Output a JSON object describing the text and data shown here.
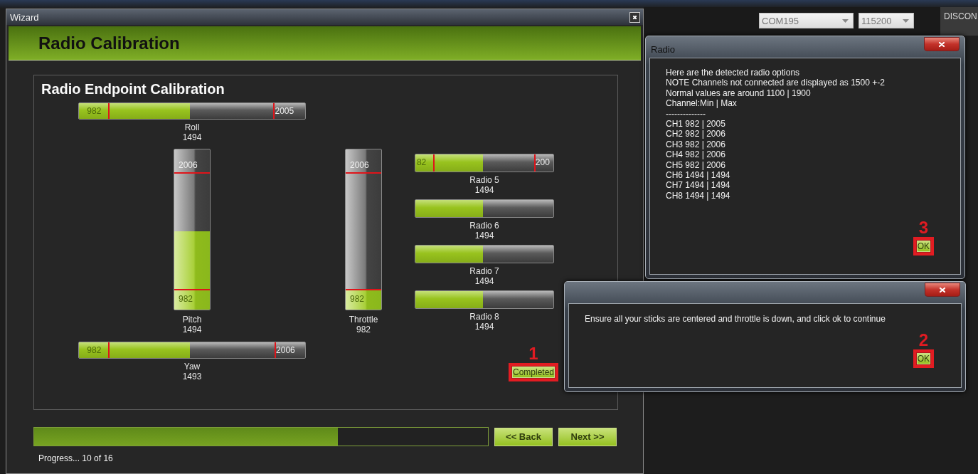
{
  "toolbar": {
    "port": "COM195",
    "baud": "115200",
    "connect_tab": "DISCON"
  },
  "wizard": {
    "title": "Wizard",
    "header": "Radio Calibration",
    "panel_title": "Radio Endpoint Calibration",
    "sticks": [
      {
        "kind": "horizontal",
        "name": "Roll",
        "value": "1494",
        "level": 0.49,
        "min": {
          "text": "982",
          "level": 0.13
        },
        "max": {
          "text": "2005",
          "level": 0.86
        }
      },
      {
        "kind": "vertical",
        "name": "Pitch",
        "value": "1494",
        "level": 0.49,
        "min": {
          "text": "982",
          "level": 0.12
        },
        "max": {
          "text": "2006",
          "level": 0.85
        }
      },
      {
        "kind": "horizontal",
        "name": "Yaw",
        "value": "1493",
        "level": 0.49,
        "min": {
          "text": "982",
          "level": 0.13
        },
        "max": {
          "text": "2006",
          "level": 0.865
        }
      },
      {
        "kind": "vertical",
        "name": "Throttle",
        "value": "982",
        "level": 0.12,
        "min": {
          "text": "982",
          "level": 0.12
        },
        "max": {
          "text": "2006",
          "level": 0.85
        }
      }
    ],
    "radios": [
      {
        "name": "Radio 5",
        "value": "1494",
        "level": 0.49,
        "min": {
          "text": "82",
          "level": 0.13
        },
        "max": {
          "text": "200",
          "level": 0.86
        }
      },
      {
        "name": "Radio 6",
        "value": "1494",
        "level": 0.49
      },
      {
        "name": "Radio 7",
        "value": "1494",
        "level": 0.49
      },
      {
        "name": "Radio 8",
        "value": "1494",
        "level": 0.49
      }
    ],
    "completed_button": {
      "label": "Completed",
      "annotation": "1"
    },
    "progress": {
      "level": 0.67,
      "text": "Progress... 10 of 16"
    },
    "buttons": [
      "<< Back",
      "Next >>"
    ]
  },
  "radio_dialog": {
    "title": "Radio",
    "lines": [
      "Here are the detected radio options",
      "NOTE Channels not connected are displayed as 1500 +-2",
      "Normal values are around 1100 | 1900",
      "Channel:Min | Max",
      "--------------",
      "CH1 982 | 2005",
      "CH2 982 | 2006",
      "CH3 982 | 2006",
      "CH4 982 | 2006",
      "CH5 982 | 2006",
      "CH6 1494 | 1494",
      "CH7 1494 | 1494",
      "CH8 1494 | 1494"
    ],
    "ok": {
      "label": "OK",
      "annotation": "3"
    }
  },
  "message_dialog": {
    "message": "Ensure all your sticks are centered and throttle is down, and click ok to continue",
    "ok": {
      "label": "OK",
      "annotation": "2"
    }
  }
}
